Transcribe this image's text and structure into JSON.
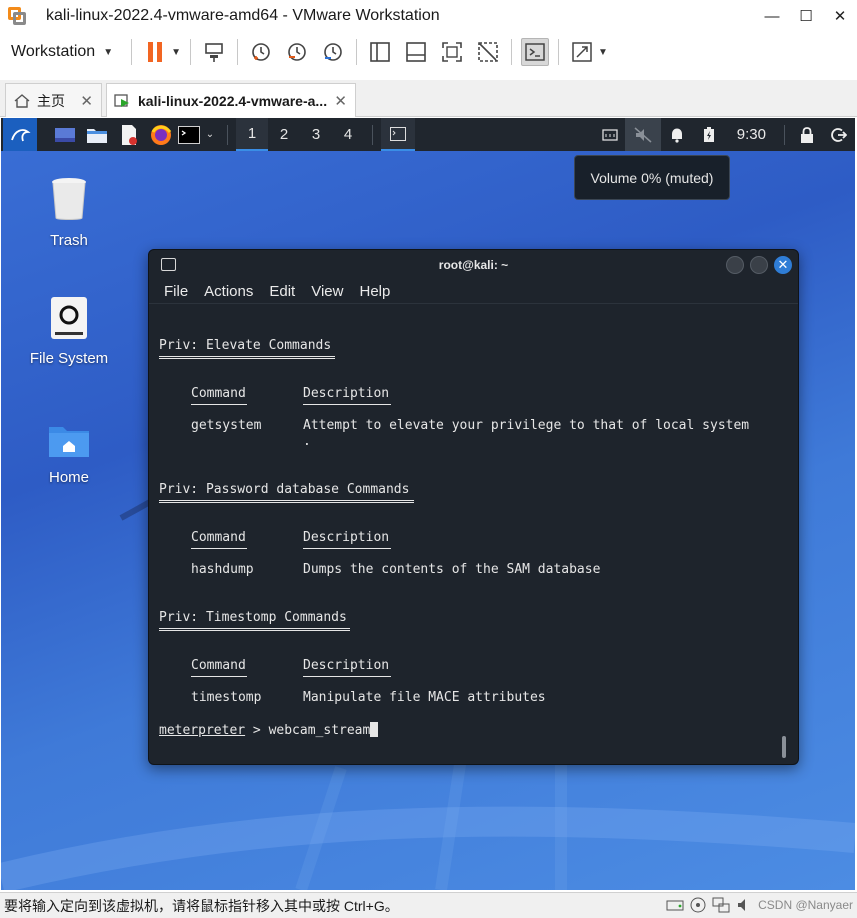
{
  "window": {
    "title": "kali-linux-2022.4-vmware-amd64 - VMware Workstation"
  },
  "toolbar": {
    "workstation_label": "Workstation"
  },
  "tabs": [
    {
      "label": "主页"
    },
    {
      "label": "kali-linux-2022.4-vmware-a..."
    }
  ],
  "guest": {
    "panel": {
      "workspaces": [
        "1",
        "2",
        "3",
        "4"
      ],
      "clock": "9:30"
    },
    "tooltip": "Volume 0% (muted)",
    "desktop_icons": [
      {
        "label": "Trash"
      },
      {
        "label": "File System"
      },
      {
        "label": "Home"
      }
    ],
    "terminal": {
      "title": "root@kali: ~",
      "menu": [
        "File",
        "Actions",
        "Edit",
        "View",
        "Help"
      ],
      "sections": [
        {
          "heading": "Priv: Elevate Commands",
          "col_command": "Command",
          "col_description": "Description",
          "row_command": "getsystem",
          "row_description": "Attempt to elevate your privilege to that of local system",
          "row_continuation": "."
        },
        {
          "heading": "Priv: Password database Commands",
          "col_command": "Command",
          "col_description": "Description",
          "row_command": "hashdump",
          "row_description": "Dumps the contents of the SAM database"
        },
        {
          "heading": "Priv: Timestomp Commands",
          "col_command": "Command",
          "col_description": "Description",
          "row_command": "timestomp",
          "row_description": "Manipulate file MACE attributes"
        }
      ],
      "prompt": "meterpreter",
      "prompt_sep": " > ",
      "input": "webcam_stream"
    }
  },
  "statusbar": {
    "text": "要将输入定向到该虚拟机，请将鼠标指针移入其中或按 Ctrl+G。",
    "watermark": "CSDN @Nanyaer"
  }
}
